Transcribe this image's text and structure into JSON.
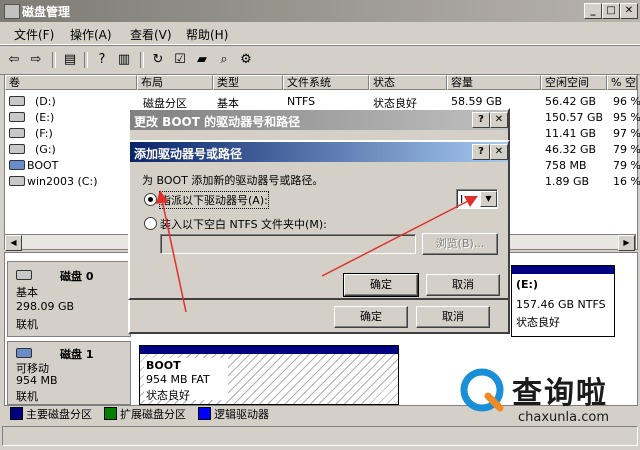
{
  "window": {
    "title": "磁盘管理"
  },
  "menu": [
    "文件(F)",
    "操作(A)",
    "查看(V)",
    "帮助(H)"
  ],
  "list": {
    "columns": [
      "卷",
      "布局",
      "类型",
      "文件系统",
      "状态",
      "容量",
      "空闲空间",
      "% 空"
    ],
    "rows": [
      [
        "(D:)",
        "磁盘分区",
        "基本",
        "NTFS",
        "状态良好",
        "58.59 GB",
        "56.42 GB",
        "96 %"
      ],
      [
        "(E:)",
        "",
        "",
        "",
        "",
        "",
        "150.57 GB",
        "95 %"
      ],
      [
        "(F:)",
        "",
        "",
        "",
        "",
        "",
        "11.41 GB",
        "97 %"
      ],
      [
        "(G:)",
        "",
        "",
        "",
        "",
        "",
        "46.32 GB",
        "79 %"
      ],
      [
        "BOOT",
        "",
        "",
        "",
        "",
        "",
        "758 MB",
        "79 %"
      ],
      [
        "win2003 (C:)",
        "",
        "",
        "",
        "",
        "",
        "1.89 GB",
        "16 %"
      ]
    ]
  },
  "disk0": {
    "name": "磁盘 0",
    "type": "基本",
    "size": "298.09 GB",
    "state": "联机",
    "part_label": "(E:)",
    "part_detail": "157.46 GB NTFS",
    "part_state": "状态良好"
  },
  "disk1": {
    "name": "磁盘 1",
    "type": "可移动",
    "size": "954 MB",
    "state": "联机",
    "part_label": "BOOT",
    "part_detail": "954 MB FAT",
    "part_state": "状态良好"
  },
  "legend": [
    {
      "label": "主要磁盘分区",
      "color": "#000080"
    },
    {
      "label": "扩展磁盘分区",
      "color": "#008000"
    },
    {
      "label": "逻辑驱动器",
      "color": "#0000ff"
    }
  ],
  "dialog_change": {
    "title": "更改 BOOT 的驱动器号和路径",
    "ok": "确定",
    "cancel": "取消"
  },
  "dialog_add": {
    "title": "添加驱动器号或路径",
    "prompt": "为 BOOT 添加新的驱动器号或路径。",
    "option_letter": "指派以下驱动器号(A):",
    "option_folder": "装入以下空白 NTFS 文件夹中(M):",
    "letter_value": "I",
    "browse": "浏览(B)...",
    "ok": "确定",
    "cancel": "取消"
  },
  "watermark": {
    "brand": "查询啦",
    "site": "chaxunla.com"
  }
}
